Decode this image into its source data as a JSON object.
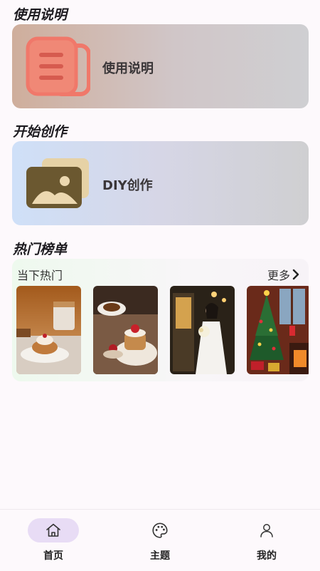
{
  "sections": {
    "guide_title": "使用说明",
    "create_title": "开始创作",
    "hot_title": "热门榜单"
  },
  "cards": {
    "guide_label": "使用说明",
    "create_label": "DIY创作"
  },
  "hot": {
    "subtitle": "当下热门",
    "more_label": "更多"
  },
  "tabbar": {
    "items": [
      {
        "label": "首页",
        "icon": "home-icon",
        "active": true
      },
      {
        "label": "主题",
        "icon": "palette-icon",
        "active": false
      },
      {
        "label": "我的",
        "icon": "person-icon",
        "active": false
      }
    ]
  },
  "colors": {
    "accent_pill": "#e8dcf5",
    "doc_icon": "#f0786a",
    "picture_icon": "#6b5830"
  }
}
